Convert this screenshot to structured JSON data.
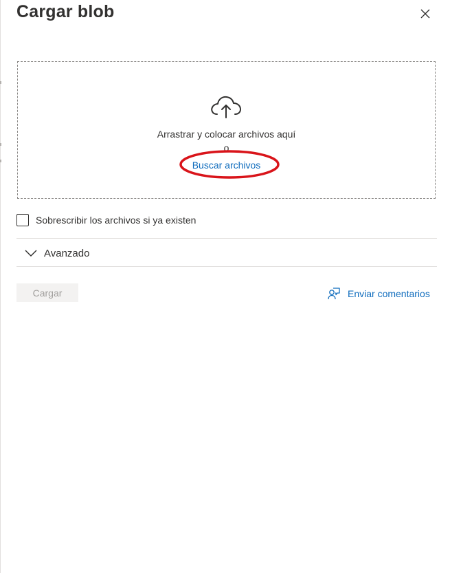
{
  "panel": {
    "title": "Cargar blob"
  },
  "dropzone": {
    "instruction": "Arrastrar y colocar archivos aquí",
    "or_text": "o",
    "browse_label": "Buscar archivos",
    "icon": "cloud-upload-icon"
  },
  "options": {
    "overwrite_label": "Sobrescribir los archivos si ya existen",
    "overwrite_checked": false,
    "advanced_label": "Avanzado",
    "advanced_expanded": false
  },
  "footer": {
    "upload_label": "Cargar",
    "upload_disabled": true,
    "feedback_label": "Enviar comentarios",
    "feedback_icon": "feedback-person-icon"
  },
  "colors": {
    "link": "#0f6cbd",
    "highlight": "#d9141a",
    "disabled_bg": "#f3f2f1",
    "disabled_text": "#a19f9d"
  }
}
